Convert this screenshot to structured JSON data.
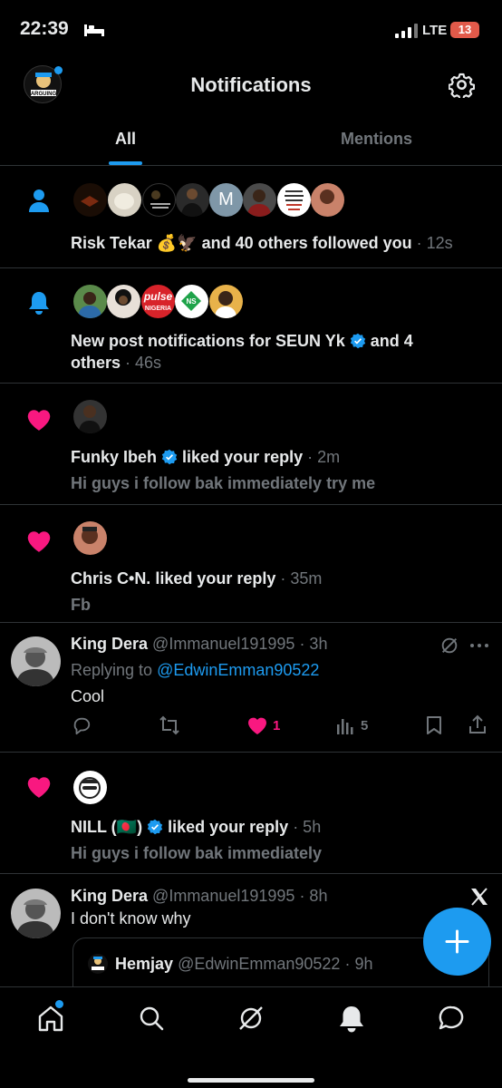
{
  "status_bar": {
    "time": "22:39",
    "network": "LTE",
    "battery": "13"
  },
  "header": {
    "title": "Notifications"
  },
  "tabs": [
    {
      "label": "All"
    },
    {
      "label": "Mentions"
    }
  ],
  "notifications": {
    "follow": {
      "name": "Risk Tekar",
      "emoji": "💰🦅",
      "text": "and 40 others followed you",
      "time": "· 12s"
    },
    "post": {
      "text_a": "New post notifications for SEUN Yk",
      "text_b": "and 4",
      "text_c": "others",
      "time": "· 46s",
      "pulse": "pulse",
      "nigeria": "NIGERIA"
    },
    "like1": {
      "name": "Funky Ibeh",
      "action": "liked your reply",
      "time": "· 2m",
      "snippet": "Hi guys i follow bak immediately try me"
    },
    "like2": {
      "name": "Chris C•N.",
      "action": "liked your reply",
      "time": "· 35m",
      "snippet": "Fb"
    },
    "reply": {
      "name": "King Dera",
      "handle": "@Immanuel191995",
      "time": "· 3h",
      "replying_label": "Replying to",
      "replying_handle": "@EdwinEmman90522",
      "body": "Cool",
      "likes": "1",
      "views": "5"
    },
    "like3": {
      "name": "NILL (🇧🇩)",
      "action": "liked your reply",
      "time": "· 5h",
      "snippet": "Hi guys i follow bak immediately"
    },
    "quote": {
      "name": "King Dera",
      "handle": "@Immanuel191995",
      "time": "· 8h",
      "body": "I don't know why",
      "quoted_name": "Hemjay",
      "quoted_handle": "@EdwinEmman90522",
      "quoted_time": "· 9h"
    }
  },
  "colors": {
    "accent": "#1d9bf0",
    "like": "#f91880",
    "background": "#000000",
    "divider": "#2f3336",
    "muted": "#71767b"
  }
}
